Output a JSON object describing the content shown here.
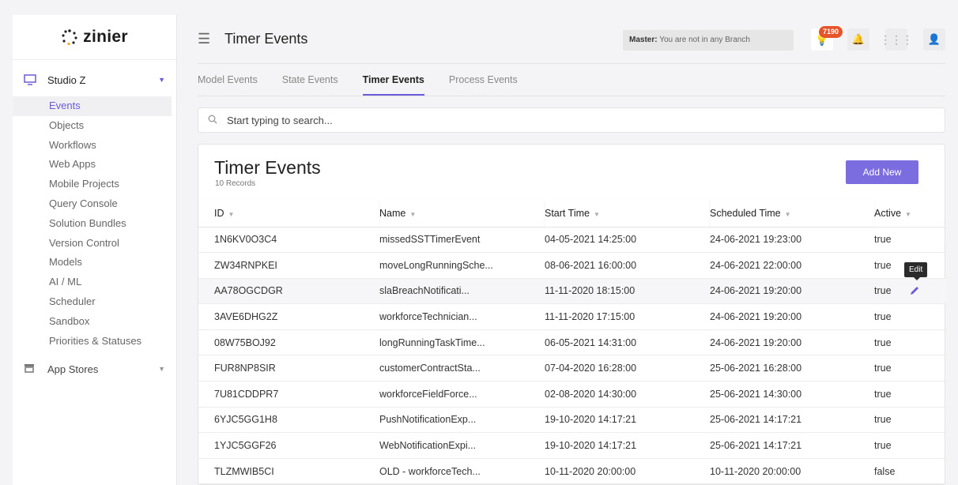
{
  "sidebar": {
    "logo_text": "zinier",
    "studio_label": "Studio Z",
    "items": [
      {
        "label": "Events",
        "active": true
      },
      {
        "label": "Objects"
      },
      {
        "label": "Workflows"
      },
      {
        "label": "Web Apps"
      },
      {
        "label": "Mobile Projects"
      },
      {
        "label": "Query Console"
      },
      {
        "label": "Solution Bundles"
      },
      {
        "label": "Version Control"
      },
      {
        "label": "Models"
      },
      {
        "label": "AI / ML"
      },
      {
        "label": "Scheduler"
      },
      {
        "label": "Sandbox"
      },
      {
        "label": "Priorities & Statuses"
      }
    ],
    "appstores_label": "App Stores"
  },
  "header": {
    "title": "Timer Events",
    "branch_label": "Master:",
    "branch_text": "You are not in any Branch",
    "notification_count": "7190"
  },
  "tabs": [
    "Model Events",
    "State Events",
    "Timer Events",
    "Process Events"
  ],
  "search": {
    "placeholder": "Start typing to search..."
  },
  "card": {
    "title": "Timer Events",
    "subtitle": "10 Records",
    "add_button": "Add New"
  },
  "table": {
    "columns": [
      "ID",
      "Name",
      "Start Time",
      "Scheduled Time",
      "Active"
    ],
    "rows": [
      [
        "1N6KV0O3C4",
        "missedSSTTimerEvent",
        "04-05-2021 14:25:00",
        "24-06-2021 19:23:00",
        "true"
      ],
      [
        "ZW34RNPKEI",
        "moveLongRunningSche...",
        "08-06-2021 16:00:00",
        "24-06-2021 22:00:00",
        "true"
      ],
      [
        "AA78OGCDGR",
        "slaBreachNotificati...",
        "11-11-2020 18:15:00",
        "24-06-2021 19:20:00",
        "true"
      ],
      [
        "3AVE6DHG2Z",
        "workforceTechnician...",
        "11-11-2020 17:15:00",
        "24-06-2021 19:20:00",
        "true"
      ],
      [
        "08W75BOJ92",
        "longRunningTaskTime...",
        "06-05-2021 14:31:00",
        "24-06-2021 19:20:00",
        "true"
      ],
      [
        "FUR8NP8SIR",
        "customerContractSta...",
        "07-04-2020 16:28:00",
        "25-06-2021 16:28:00",
        "true"
      ],
      [
        "7U81CDDPR7",
        "workforceFieldForce...",
        "02-08-2020 14:30:00",
        "25-06-2021 14:30:00",
        "true"
      ],
      [
        "6YJC5GG1H8",
        "PushNotificationExp...",
        "19-10-2020 14:17:21",
        "25-06-2021 14:17:21",
        "true"
      ],
      [
        "1YJC5GGF26",
        "WebNotificationExpi...",
        "19-10-2020 14:17:21",
        "25-06-2021 14:17:21",
        "true"
      ],
      [
        "TLZMWIB5CI",
        "OLD - workforceTech...",
        "10-11-2020 20:00:00",
        "10-11-2020 20:00:00",
        "false"
      ]
    ]
  },
  "tooltip": "Edit",
  "colors": {
    "accent": "#6b5bd6",
    "button": "#7b6cdf",
    "badge": "#e8542a"
  }
}
